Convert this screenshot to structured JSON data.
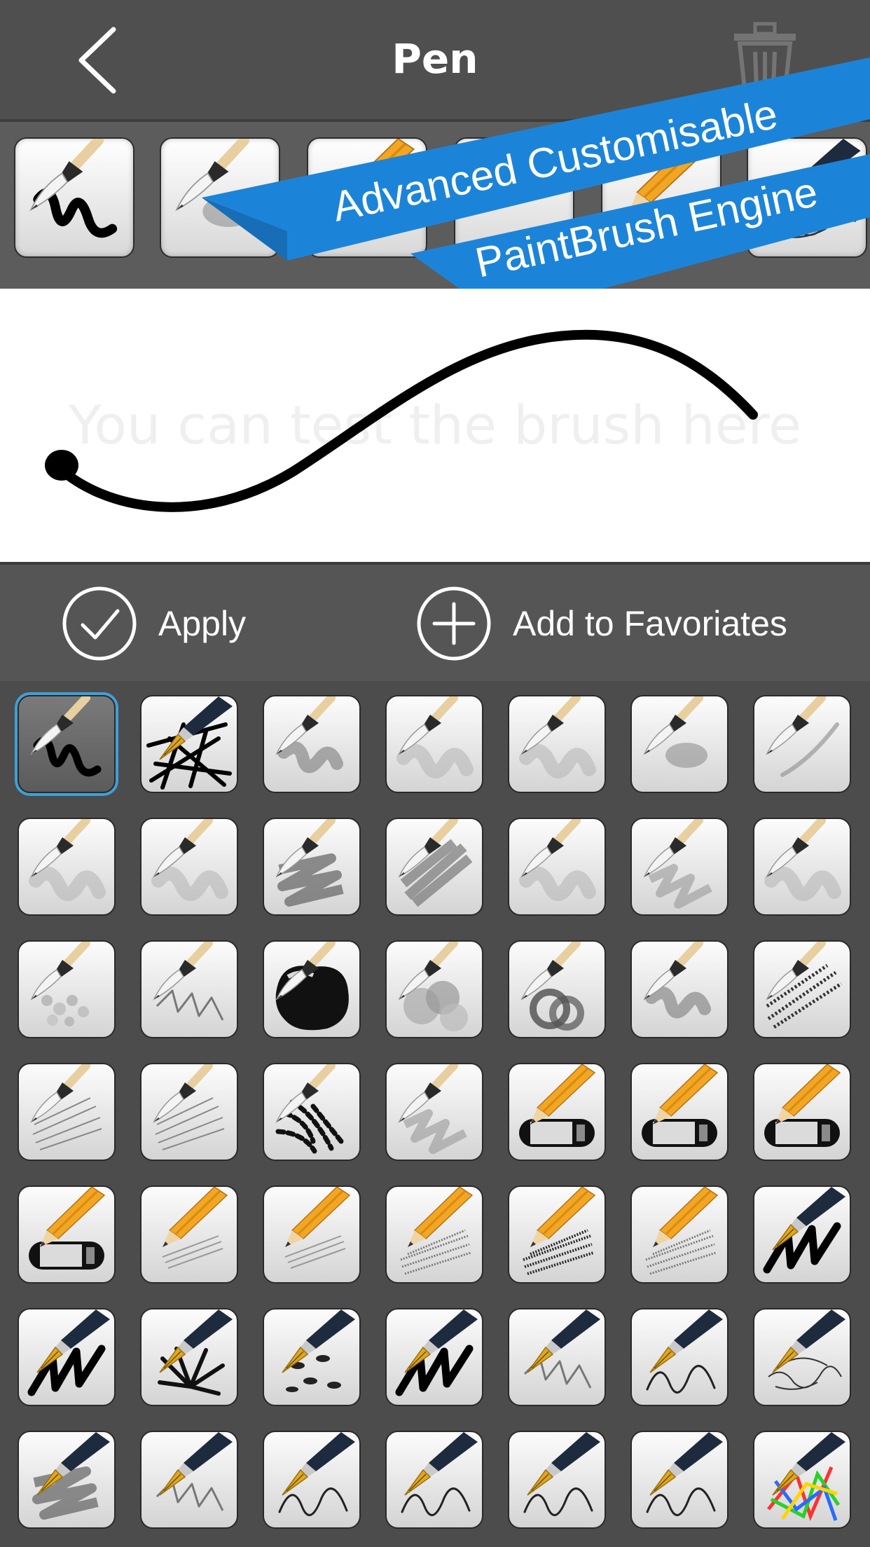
{
  "header": {
    "title": "Pen"
  },
  "promo": {
    "line1": "Advanced Customisable",
    "line2": "PaintBrush Engine"
  },
  "canvas": {
    "hint": "You can test the brush here"
  },
  "actions": {
    "apply_label": "Apply",
    "add_favorites_label": "Add to Favoriates"
  },
  "icons": {
    "back": "chevron-left-icon",
    "trash": "trash-icon",
    "apply": "check-circle-icon",
    "add": "plus-circle-icon"
  },
  "colors": {
    "accent_blue": "#1c84d8",
    "selection": "#3fa0d8",
    "pencil": "#f2a623"
  },
  "favorites": [
    {
      "tool": "brush",
      "stroke": "squiggle-bold"
    },
    {
      "tool": "brush",
      "stroke": "soft-blob"
    },
    {
      "tool": "pencil",
      "stroke": "none"
    },
    {
      "tool": "pencil",
      "stroke": "none"
    },
    {
      "tool": "pencil",
      "stroke": "none"
    },
    {
      "tool": "pen",
      "stroke": "sketch"
    }
  ],
  "brushes": [
    {
      "tool": "brush",
      "stroke": "squiggle-bold",
      "selected": true
    },
    {
      "tool": "pen",
      "stroke": "scribble-bold"
    },
    {
      "tool": "brush",
      "stroke": "soft-gray"
    },
    {
      "tool": "brush",
      "stroke": "soft-light"
    },
    {
      "tool": "brush",
      "stroke": "soft-light"
    },
    {
      "tool": "brush",
      "stroke": "soft-blob"
    },
    {
      "tool": "brush",
      "stroke": "thin-curve"
    },
    {
      "tool": "brush",
      "stroke": "soft-light"
    },
    {
      "tool": "brush",
      "stroke": "soft-light"
    },
    {
      "tool": "brush",
      "stroke": "zigzag-gray"
    },
    {
      "tool": "brush",
      "stroke": "hatch-gray"
    },
    {
      "tool": "brush",
      "stroke": "soft-light"
    },
    {
      "tool": "brush",
      "stroke": "zigzag-light"
    },
    {
      "tool": "brush",
      "stroke": "soft-light"
    },
    {
      "tool": "brush",
      "stroke": "dots-light"
    },
    {
      "tool": "brush",
      "stroke": "zigzag-thin"
    },
    {
      "tool": "brush",
      "stroke": "ink-blob"
    },
    {
      "tool": "brush",
      "stroke": "cloud-gray"
    },
    {
      "tool": "brush",
      "stroke": "smoke"
    },
    {
      "tool": "brush",
      "stroke": "soft-gray"
    },
    {
      "tool": "brush",
      "stroke": "hatch-dark"
    },
    {
      "tool": "brush",
      "stroke": "hatch-light"
    },
    {
      "tool": "brush",
      "stroke": "hatch-light"
    },
    {
      "tool": "brush",
      "stroke": "splatter"
    },
    {
      "tool": "brush",
      "stroke": "zigzag-light"
    },
    {
      "tool": "pencil",
      "stroke": "eraser"
    },
    {
      "tool": "pencil",
      "stroke": "eraser"
    },
    {
      "tool": "pencil",
      "stroke": "eraser"
    },
    {
      "tool": "pencil",
      "stroke": "eraser"
    },
    {
      "tool": "pencil",
      "stroke": "pencil-light"
    },
    {
      "tool": "pencil",
      "stroke": "pencil-light"
    },
    {
      "tool": "pencil",
      "stroke": "pencil-mid"
    },
    {
      "tool": "pencil",
      "stroke": "pencil-dark"
    },
    {
      "tool": "pencil",
      "stroke": "pencil-mid"
    },
    {
      "tool": "pen",
      "stroke": "zigzag-ink"
    },
    {
      "tool": "pen",
      "stroke": "zigzag-ink"
    },
    {
      "tool": "pen",
      "stroke": "grass"
    },
    {
      "tool": "pen",
      "stroke": "leaves"
    },
    {
      "tool": "pen",
      "stroke": "zigzag-ink"
    },
    {
      "tool": "pen",
      "stroke": "zigzag-thin"
    },
    {
      "tool": "pen",
      "stroke": "line-thin"
    },
    {
      "tool": "pen",
      "stroke": "sketch"
    },
    {
      "tool": "pen",
      "stroke": "zigzag-gray"
    },
    {
      "tool": "pen",
      "stroke": "zigzag-thin"
    },
    {
      "tool": "pen",
      "stroke": "line-thin"
    },
    {
      "tool": "pen",
      "stroke": "line-thin"
    },
    {
      "tool": "pen",
      "stroke": "line-thin"
    },
    {
      "tool": "pen",
      "stroke": "line-thin"
    },
    {
      "tool": "pen",
      "stroke": "rainbow"
    }
  ]
}
